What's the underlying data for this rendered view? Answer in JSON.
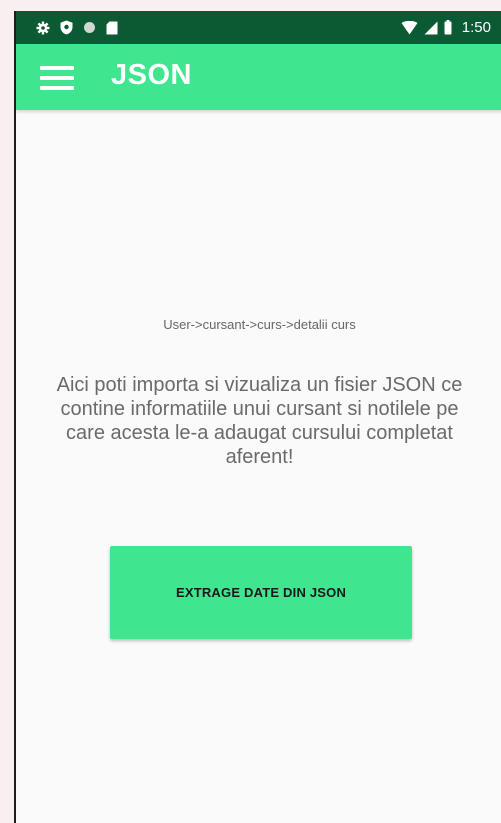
{
  "status_bar": {
    "time": "1:50",
    "left_icons": [
      "settings-icon",
      "shield-icon",
      "circle-icon",
      "sd-card-icon"
    ],
    "right_icons": [
      "wifi-icon",
      "signal-icon",
      "battery-icon"
    ]
  },
  "app_bar": {
    "title": "JSON",
    "menu_icon": "hamburger-menu-icon",
    "color": "#40e68f"
  },
  "main": {
    "breadcrumb": "User->cursant->curs->detalii curs",
    "description": "Aici poti importa si vizualiza un fisier JSON ce contine informatiile unui cursant si notilele pe care acesta le-a adaugat cursului completat aferent!",
    "button_label": "EXTRAGE DATE DIN JSON"
  },
  "colors": {
    "accent": "#40e68f",
    "status_bar": "#0b5a34",
    "background": "#fafafa"
  }
}
